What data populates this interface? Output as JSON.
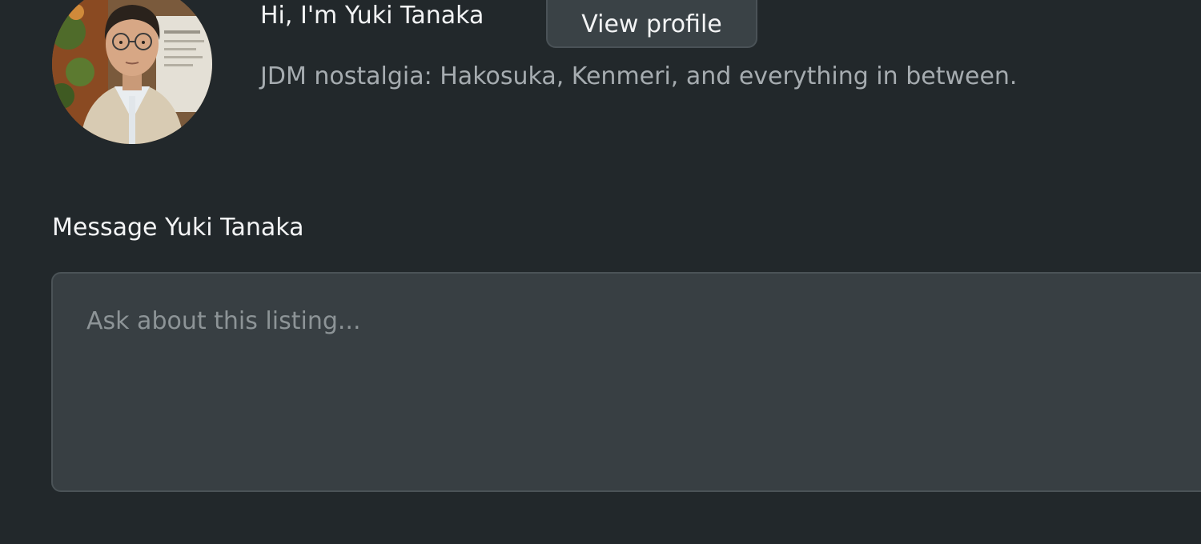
{
  "host": {
    "greeting": "Hi, I'm Yuki Tanaka",
    "view_profile_label": "View profile",
    "bio": "JDM nostalgia: Hakosuka, Kenmeri, and everything in between."
  },
  "message": {
    "label": "Message Yuki Tanaka",
    "placeholder": "Ask about this listing...",
    "value": ""
  },
  "theme": {
    "background": "#22282b",
    "input_background": "#383f43",
    "button_background": "#3a4246",
    "text_primary": "#f3f4f5",
    "text_secondary": "#a6acb0"
  }
}
